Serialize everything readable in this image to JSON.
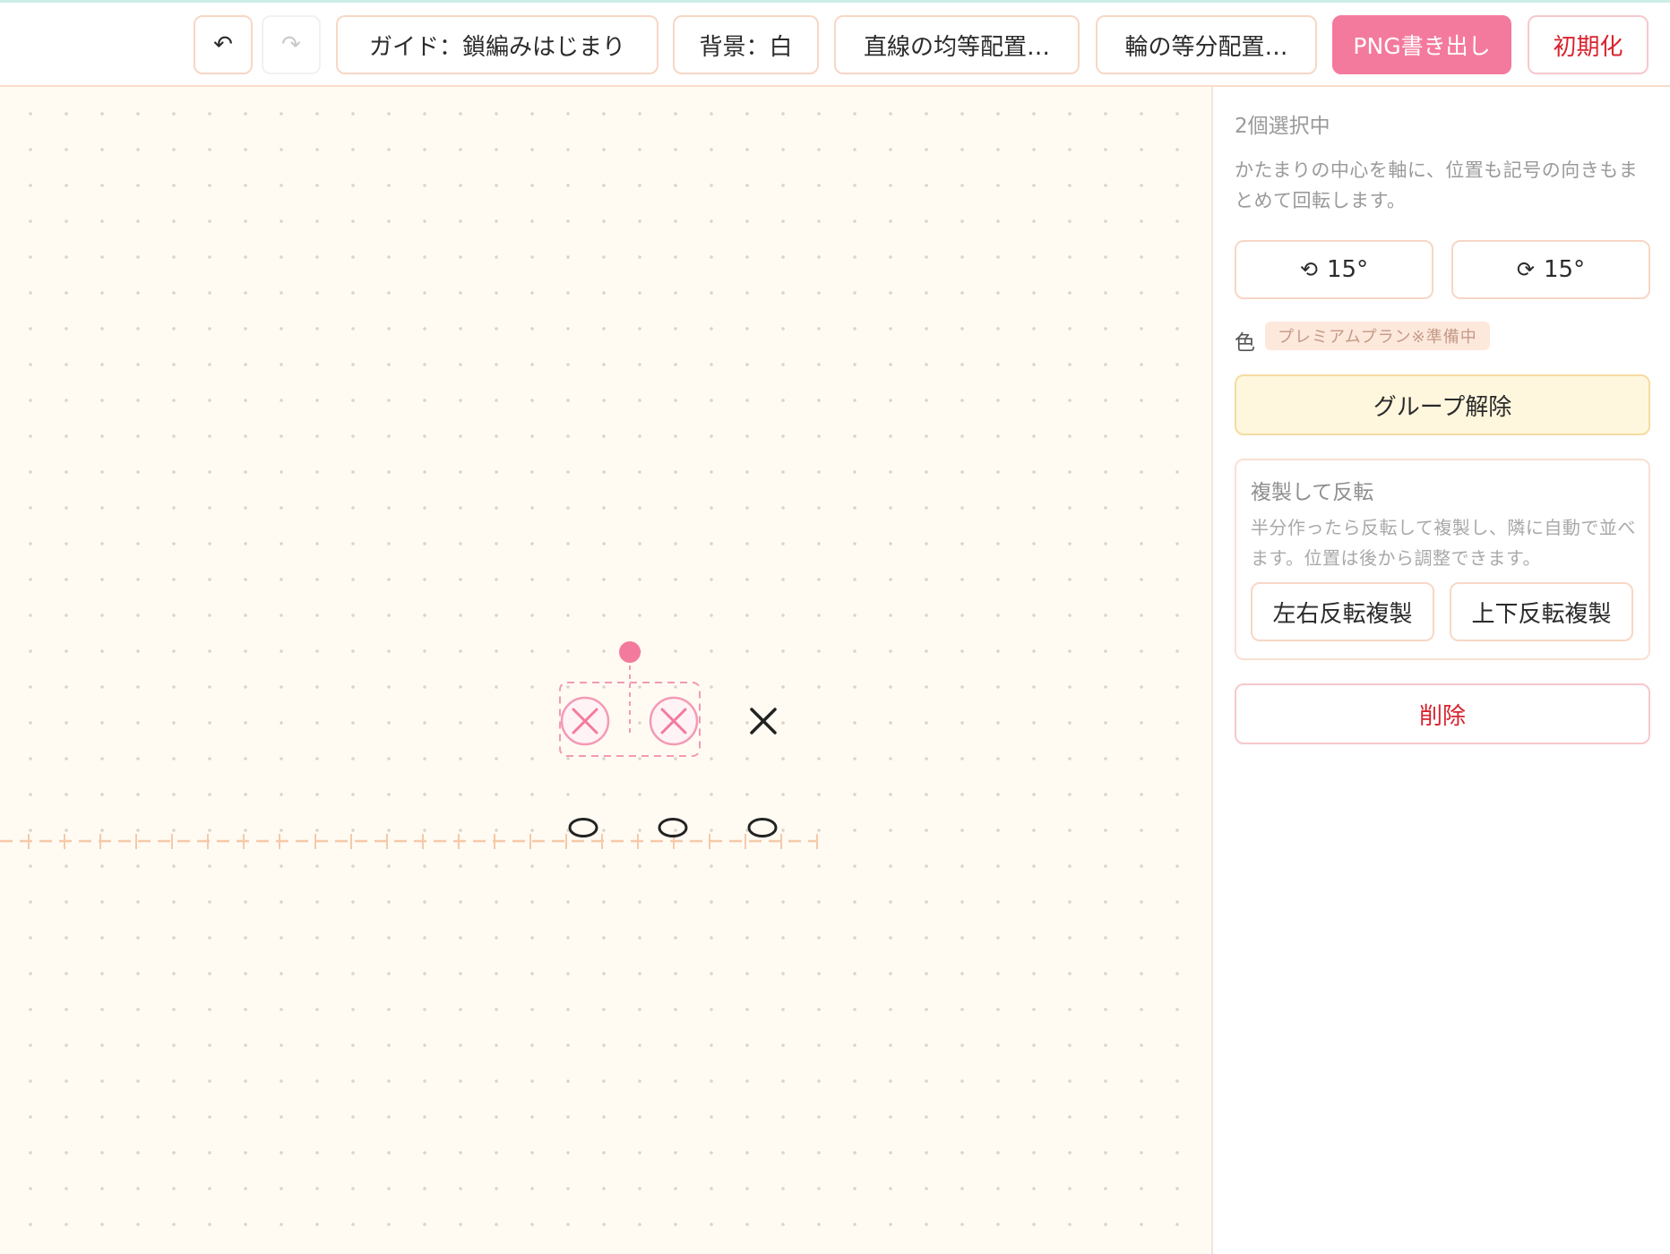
{
  "toolbar": {
    "undo_icon": "undo-arrow-icon",
    "undo_glyph": "↶",
    "redo_icon": "redo-arrow-icon",
    "redo_glyph": "↷",
    "guide_label": "ガイド：鎖編みはじまり",
    "background_label": "背景：白",
    "linear_arrange_label": "直線の均等配置…",
    "ring_arrange_label": "輪の等分配置…",
    "export_label": "PNG書き出し",
    "reset_label": "初期化"
  },
  "panel": {
    "selection_count": "2個選択中",
    "rotate_hint": "かたまりの中心を軸に、位置も記号の向きもまとめて回転します。",
    "rotate_ccw": {
      "icon": "rotate-ccw-icon",
      "glyph": "⟲",
      "label": "15°"
    },
    "rotate_cw": {
      "icon": "rotate-cw-icon",
      "glyph": "⟳",
      "label": "15°"
    },
    "color_label": "色",
    "premium_badge": "プレミアムプラン※準備中",
    "ungroup_label": "グループ解除",
    "duplicate_flip": {
      "title": "複製して反転",
      "hint": "半分作ったら反転して複製し、隣に自動で並べます。位置は後から調整できます。",
      "flip_horizontal_label": "左右反転複製",
      "flip_vertical_label": "上下反転複製"
    },
    "delete_label": "削除"
  },
  "colors": {
    "accent_pink": "#f47a9d",
    "selection_pink": "#f39ab5",
    "guide_orange": "#f6c9a8",
    "danger_red": "#d8232f",
    "canvas_bg": "#fffbf3",
    "stitch_ink": "#222222"
  },
  "canvas": {
    "stitch_icons": [
      "chain-stitch-icon",
      "single-crochet-icon",
      "rotation-handle-icon"
    ]
  }
}
